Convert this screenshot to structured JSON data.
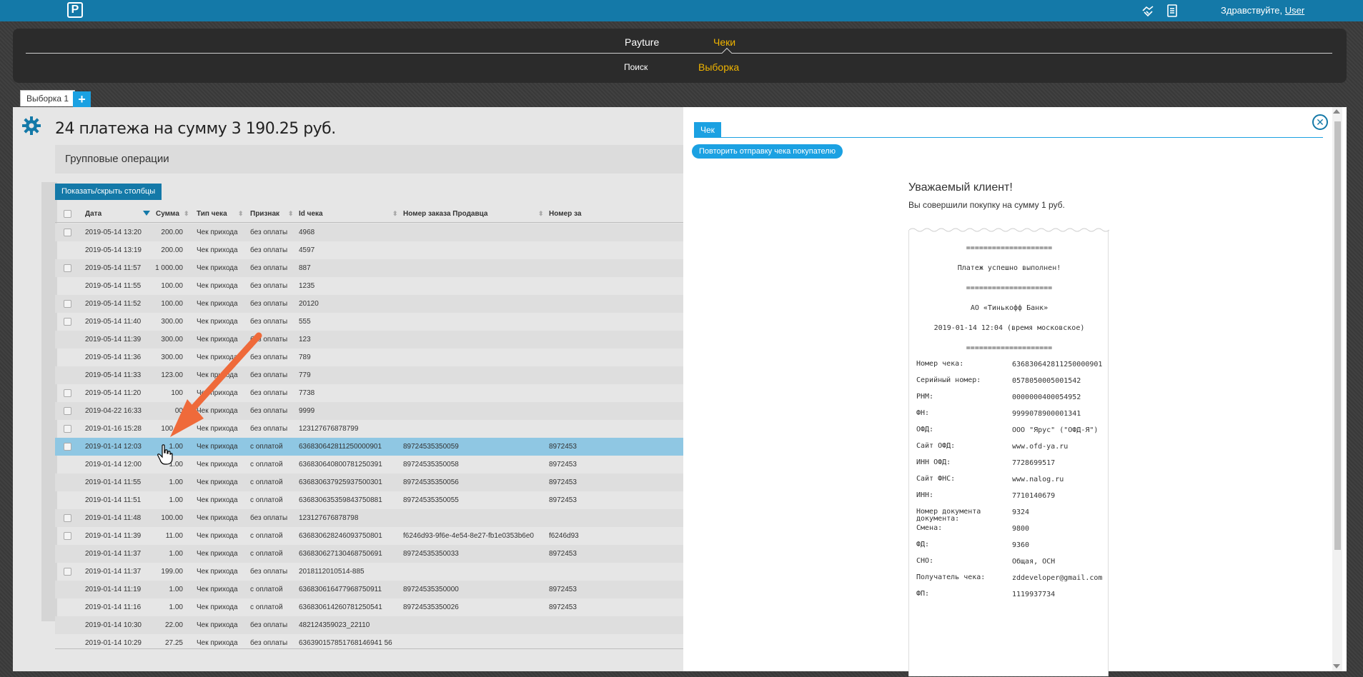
{
  "topbar": {
    "logo": "P",
    "greeting": "Здравствуйте,",
    "user": "User",
    "icons": [
      "handshake-icon",
      "document-list-icon"
    ]
  },
  "nav": {
    "top": [
      "Payture",
      "Чеки"
    ],
    "sub": [
      "Поиск",
      "Выборка"
    ],
    "active_color": "#f0b400"
  },
  "tabs": {
    "tab1": "Выборка 1",
    "add": "+"
  },
  "main": {
    "title": "24 платежа на сумму 3 190.25 руб.",
    "group_ops": "Групповые операции",
    "toggle_columns": "Показать/скрыть столбцы"
  },
  "grid": {
    "columns": [
      "Дата",
      "Сумма",
      "Тип чека",
      "Признак",
      "Id чека",
      "Номер заказа Продавца",
      "Номер за"
    ],
    "rows": [
      {
        "cb": true,
        "date": "2019-05-14 13:20",
        "sum": "200.00",
        "type": "Чек прихода",
        "sign": "без оплаты",
        "id": "4968",
        "order": "",
        "order2": ""
      },
      {
        "cb": false,
        "date": "2019-05-14 13:19",
        "sum": "200.00",
        "type": "Чек прихода",
        "sign": "без оплаты",
        "id": "4597",
        "order": "",
        "order2": ""
      },
      {
        "cb": true,
        "date": "2019-05-14 11:57",
        "sum": "1 000.00",
        "type": "Чек прихода",
        "sign": "без оплаты",
        "id": "887",
        "order": "",
        "order2": ""
      },
      {
        "cb": false,
        "date": "2019-05-14 11:55",
        "sum": "100.00",
        "type": "Чек прихода",
        "sign": "без оплаты",
        "id": "1235",
        "order": "",
        "order2": ""
      },
      {
        "cb": true,
        "date": "2019-05-14 11:52",
        "sum": "100.00",
        "type": "Чек прихода",
        "sign": "без оплаты",
        "id": "20120",
        "order": "",
        "order2": ""
      },
      {
        "cb": true,
        "date": "2019-05-14 11:40",
        "sum": "300.00",
        "type": "Чек прихода",
        "sign": "без оплаты",
        "id": "555",
        "order": "",
        "order2": ""
      },
      {
        "cb": false,
        "date": "2019-05-14 11:39",
        "sum": "300.00",
        "type": "Чек прихода",
        "sign": "без оплаты",
        "id": "123",
        "order": "",
        "order2": ""
      },
      {
        "cb": false,
        "date": "2019-05-14 11:36",
        "sum": "300.00",
        "type": "Чек прихода",
        "sign": "без оплаты",
        "id": "789",
        "order": "",
        "order2": ""
      },
      {
        "cb": false,
        "date": "2019-05-14 11:33",
        "sum": "123.00",
        "type": "Чек прихода",
        "sign": "без оплаты",
        "id": "779",
        "order": "",
        "order2": ""
      },
      {
        "cb": true,
        "date": "2019-05-14 11:20",
        "sum": "100",
        "type": "Чек прихода",
        "sign": "без оплаты",
        "id": "7738",
        "order": "",
        "order2": ""
      },
      {
        "cb": true,
        "date": "2019-04-22 16:33",
        "sum": "00",
        "type": "Чек прихода",
        "sign": "без оплаты",
        "id": "9999",
        "order": "",
        "order2": ""
      },
      {
        "cb": true,
        "date": "2019-01-16 15:28",
        "sum": "100.00",
        "type": "Чек прихода",
        "sign": "без оплаты",
        "id": "123127676878799",
        "order": "",
        "order2": ""
      },
      {
        "cb": true,
        "date": "2019-01-14 12:03",
        "sum": "1.00",
        "type": "Чек прихода",
        "sign": "с оплатой",
        "id": "636830642811250000901",
        "order": "89724535350059",
        "order2": "8972453"
      },
      {
        "cb": false,
        "date": "2019-01-14 12:00",
        "sum": "1.00",
        "type": "Чек прихода",
        "sign": "с оплатой",
        "id": "636830640800781250391",
        "order": "89724535350058",
        "order2": "8972453"
      },
      {
        "cb": false,
        "date": "2019-01-14 11:55",
        "sum": "1.00",
        "type": "Чек прихода",
        "sign": "с оплатой",
        "id": "636830637925937500301",
        "order": "89724535350056",
        "order2": "8972453"
      },
      {
        "cb": false,
        "date": "2019-01-14 11:51",
        "sum": "1.00",
        "type": "Чек прихода",
        "sign": "с оплатой",
        "id": "636830635359843750881",
        "order": "89724535350055",
        "order2": "8972453"
      },
      {
        "cb": true,
        "date": "2019-01-14 11:48",
        "sum": "100.00",
        "type": "Чек прихода",
        "sign": "без оплаты",
        "id": "123127676878798",
        "order": "",
        "order2": ""
      },
      {
        "cb": true,
        "date": "2019-01-14 11:39",
        "sum": "11.00",
        "type": "Чек прихода",
        "sign": "с оплатой",
        "id": "636830628246093750801",
        "order": "f6246d93-9f6e-4e54-8e27-fb1e0353b6e0",
        "order2": "f6246d93"
      },
      {
        "cb": false,
        "date": "2019-01-14 11:37",
        "sum": "1.00",
        "type": "Чек прихода",
        "sign": "с оплатой",
        "id": "636830627130468750691",
        "order": "89724535350033",
        "order2": "8972453"
      },
      {
        "cb": true,
        "date": "2019-01-14 11:37",
        "sum": "199.00",
        "type": "Чек прихода",
        "sign": "без оплаты",
        "id": "2018112010514-885",
        "order": "",
        "order2": ""
      },
      {
        "cb": false,
        "date": "2019-01-14 11:19",
        "sum": "1.00",
        "type": "Чек прихода",
        "sign": "с оплатой",
        "id": "636830616477968750911",
        "order": "89724535350000",
        "order2": "8972453"
      },
      {
        "cb": false,
        "date": "2019-01-14 11:16",
        "sum": "1.00",
        "type": "Чек прихода",
        "sign": "с оплатой",
        "id": "636830614260781250541",
        "order": "89724535350026",
        "order2": "8972453"
      },
      {
        "cb": false,
        "date": "2019-01-14 10:30",
        "sum": "22.00",
        "type": "Чек прихода",
        "sign": "без оплаты",
        "id": "482124359023_22110",
        "order": "",
        "order2": ""
      },
      {
        "cb": false,
        "date": "2019-01-14 10:29",
        "sum": "27.25",
        "type": "Чек прихода",
        "sign": "без оплаты",
        "id": "636390157851768146941 56",
        "order": "",
        "order2": ""
      }
    ],
    "selected_index": 12,
    "selected_color": "#8fc7e3"
  },
  "panel": {
    "tab": "Чек",
    "resend": "Повторить отправку чека покупателю",
    "greeting": "Уважаемый клиент!",
    "subtitle": "Вы совершили покупку на сумму 1 руб.",
    "receipt": {
      "sep": "====================",
      "status": "Платеж успешно выполнен!",
      "bank": "АО «Тинькофф Банк»",
      "datetime": "2019-01-14 12:04 (время московское)",
      "fields": [
        {
          "k": "Номер чека:",
          "v": "636830642811250000901"
        },
        {
          "k": "Серийный номер:",
          "v": "0578050005001542"
        },
        {
          "k": "РНМ:",
          "v": "0000000400054952"
        },
        {
          "k": "ФН:",
          "v": "9999078900001341"
        },
        {
          "k": "ОФД:",
          "v": "ООО \"Ярус\" (\"ОФД-Я\")"
        },
        {
          "k": "Сайт ОФД:",
          "v": "www.ofd-ya.ru"
        },
        {
          "k": "ИНН ОФД:",
          "v": "7728699517"
        },
        {
          "k": "Сайт ФНС:",
          "v": "www.nalog.ru"
        },
        {
          "k": "ИНН:",
          "v": "7710140679"
        },
        {
          "k": "Номер документа документа:",
          "v": "9324"
        },
        {
          "k": "Смена:",
          "v": "9800"
        },
        {
          "k": "ФД:",
          "v": "9360"
        },
        {
          "k": "СНО:",
          "v": "Общая, ОСН"
        },
        {
          "k": "Получатель чека:",
          "v": "zddeveloper@gmail.com"
        },
        {
          "k": "ФП:",
          "v": "1119937734"
        }
      ]
    }
  },
  "annotation_color": "#ef6a3a"
}
